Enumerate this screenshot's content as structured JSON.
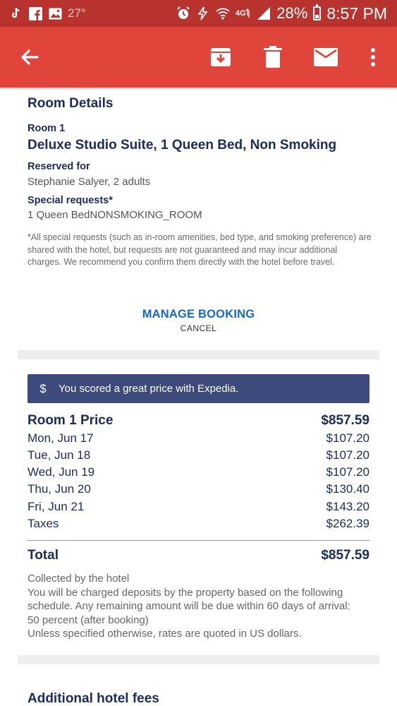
{
  "status_bar": {
    "temperature": "27°",
    "signal_label": "4G",
    "battery": "28%",
    "time": "8:57 PM"
  },
  "app_bar": {
    "icons": [
      "back-arrow-icon",
      "archive-icon",
      "trash-icon",
      "mail-icon",
      "more-vert-icon"
    ]
  },
  "room": {
    "heading": "Room Details",
    "room_label": "Room 1",
    "room_name": "Deluxe Studio Suite, 1 Queen Bed, Non Smoking",
    "reserved_label": "Reserved for",
    "reserved_value": "Stephanie Salyer, 2 adults",
    "requests_label": "Special requests*",
    "requests_value": "1 Queen BedNONSMOKING_ROOM",
    "disclaimer": "*All special requests (such as in-room amenities, bed type, and smoking preference) are shared with the hotel, but requests are not guaranteed and may incur additional charges. We recommend you confirm them directly with the hotel before travel.",
    "manage_label": "MANAGE BOOKING",
    "cancel_label": "CANCEL"
  },
  "price": {
    "banner_symbol": "$",
    "banner_text": "You scored a great price with Expedia.",
    "title": "Room 1 Price",
    "title_amount": "$857.59",
    "lines": [
      {
        "label": "Mon, Jun 17",
        "amount": "$107.20"
      },
      {
        "label": "Tue, Jun 18",
        "amount": "$107.20"
      },
      {
        "label": "Wed, Jun 19",
        "amount": "$107.20"
      },
      {
        "label": "Thu, Jun 20",
        "amount": "$130.40"
      },
      {
        "label": "Fri, Jun 21",
        "amount": "$143.20"
      },
      {
        "label": "Taxes",
        "amount": "$262.39"
      }
    ],
    "total_label": "Total",
    "total_amount": "$857.59",
    "notes": [
      "Collected by the hotel",
      "You will be charged deposits by the property based on the following schedule. Any remaining amount will be due within 60 days of arrival:",
      "50 percent (after booking)",
      "Unless specified otherwise, rates are quoted in US dollars."
    ]
  },
  "fees": {
    "heading": "Additional hotel fees"
  },
  "colors": {
    "status_bar": "#b8332d",
    "app_bar": "#e0453c",
    "navy": "#1c2b5e",
    "link": "#1769c7",
    "banner": "#3d4a7c"
  }
}
